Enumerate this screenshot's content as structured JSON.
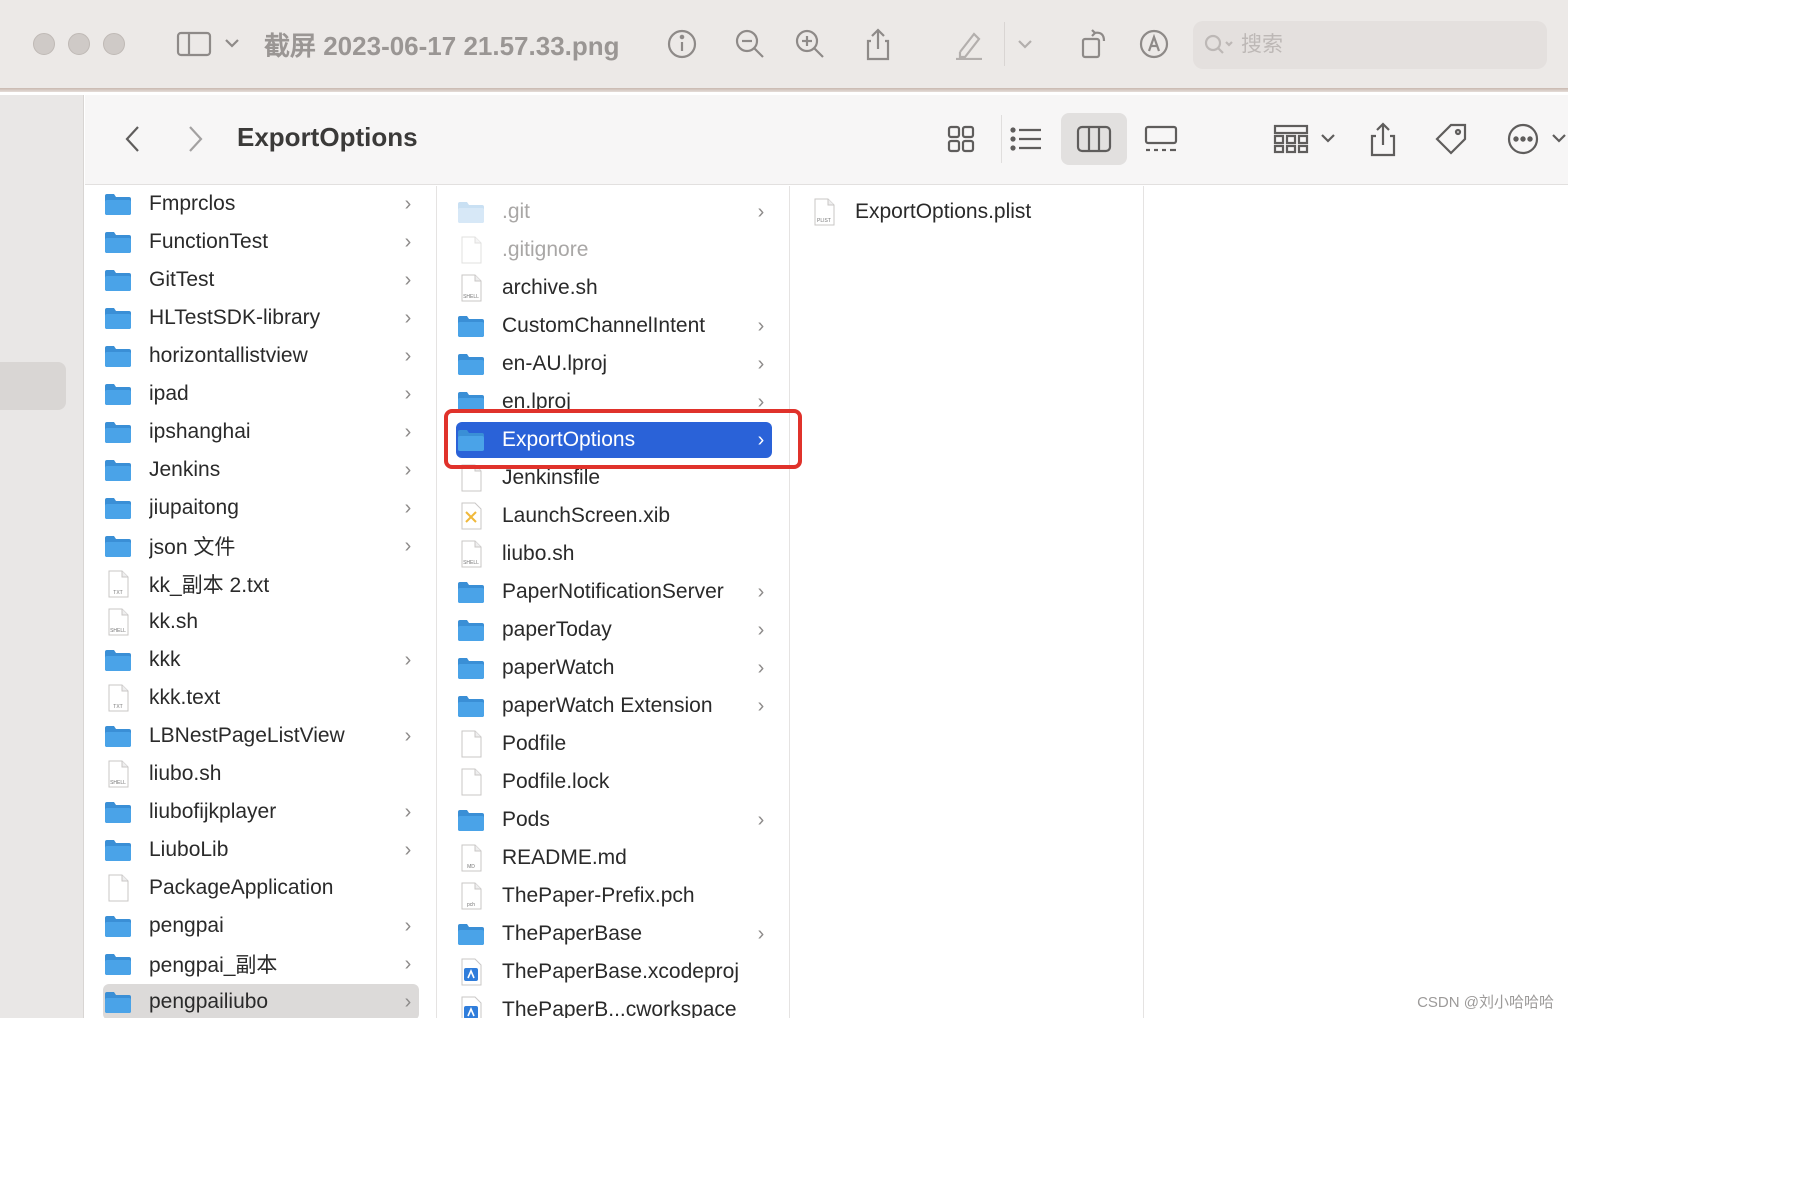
{
  "window": {
    "doc_title": "截屏 2023-06-17 21.57.33.png",
    "search_placeholder": "搜索"
  },
  "finder": {
    "title": "ExportOptions"
  },
  "columns": {
    "col1": [
      {
        "label": "Fmprclos",
        "kind": "folder",
        "chevron": true
      },
      {
        "label": "FunctionTest",
        "kind": "folder",
        "chevron": true
      },
      {
        "label": "GitTest",
        "kind": "folder",
        "chevron": true
      },
      {
        "label": "HLTestSDK-library",
        "kind": "folder",
        "chevron": true
      },
      {
        "label": "horizontallistview",
        "kind": "folder",
        "chevron": true
      },
      {
        "label": "ipad",
        "kind": "folder",
        "chevron": true
      },
      {
        "label": "ipshanghai",
        "kind": "folder",
        "chevron": true
      },
      {
        "label": "Jenkins",
        "kind": "folder",
        "chevron": true
      },
      {
        "label": "jiupaitong",
        "kind": "folder",
        "chevron": true
      },
      {
        "label": "json 文件",
        "kind": "folder",
        "chevron": true
      },
      {
        "label": "kk_副本 2.txt",
        "kind": "txt",
        "chevron": false
      },
      {
        "label": "kk.sh",
        "kind": "shell",
        "chevron": false
      },
      {
        "label": "kkk",
        "kind": "folder",
        "chevron": true
      },
      {
        "label": "kkk.text",
        "kind": "txt",
        "chevron": false
      },
      {
        "label": "LBNestPageListView",
        "kind": "folder",
        "chevron": true
      },
      {
        "label": "liubo.sh",
        "kind": "shell",
        "chevron": false
      },
      {
        "label": "liubofijkplayer",
        "kind": "folder",
        "chevron": true
      },
      {
        "label": "LiuboLib",
        "kind": "folder",
        "chevron": true
      },
      {
        "label": "PackageApplication",
        "kind": "file",
        "chevron": false
      },
      {
        "label": "pengpai",
        "kind": "folder",
        "chevron": true
      },
      {
        "label": "pengpai_副本",
        "kind": "folder",
        "chevron": true
      },
      {
        "label": "pengpailiubo",
        "kind": "folder",
        "chevron": true,
        "state": "parent-selected"
      }
    ],
    "col2": [
      {
        "label": ".git",
        "kind": "folder",
        "chevron": true,
        "state": "dim"
      },
      {
        "label": ".gitignore",
        "kind": "file",
        "chevron": false,
        "state": "dim"
      },
      {
        "label": "archive.sh",
        "kind": "shell",
        "chevron": false
      },
      {
        "label": "CustomChannelIntent",
        "kind": "folder",
        "chevron": true
      },
      {
        "label": "en-AU.lproj",
        "kind": "folder",
        "chevron": true
      },
      {
        "label": "en.lproj",
        "kind": "folder",
        "chevron": true
      },
      {
        "label": "ExportOptions",
        "kind": "folder",
        "chevron": true,
        "state": "selected"
      },
      {
        "label": "Jenkinsfile",
        "kind": "file",
        "chevron": false
      },
      {
        "label": "LaunchScreen.xib",
        "kind": "xib",
        "chevron": false
      },
      {
        "label": "liubo.sh",
        "kind": "shell",
        "chevron": false
      },
      {
        "label": "PaperNotificationServer",
        "kind": "folder",
        "chevron": true
      },
      {
        "label": "paperToday",
        "kind": "folder",
        "chevron": true
      },
      {
        "label": "paperWatch",
        "kind": "folder",
        "chevron": true
      },
      {
        "label": "paperWatch Extension",
        "kind": "folder",
        "chevron": true
      },
      {
        "label": "Podfile",
        "kind": "file",
        "chevron": false
      },
      {
        "label": "Podfile.lock",
        "kind": "file",
        "chevron": false
      },
      {
        "label": "Pods",
        "kind": "folder",
        "chevron": true
      },
      {
        "label": "README.md",
        "kind": "md",
        "chevron": false
      },
      {
        "label": "ThePaper-Prefix.pch",
        "kind": "pch",
        "chevron": false
      },
      {
        "label": "ThePaperBase",
        "kind": "folder",
        "chevron": true
      },
      {
        "label": "ThePaperBase.xcodeproj",
        "kind": "xcode",
        "chevron": false
      },
      {
        "label": "ThePaperB...cworkspace",
        "kind": "xcode",
        "chevron": false
      }
    ],
    "col3": [
      {
        "label": "ExportOptions.plist",
        "kind": "plist",
        "chevron": false
      }
    ]
  },
  "file_type_tags": {
    "txt": "TXT",
    "shell": "SHELL",
    "md": "MD",
    "pch": "pch",
    "plist": "PLIST"
  },
  "colors": {
    "selection": "#2a62d8",
    "highlight_box": "#e0322b",
    "folder": "#4aa3e8"
  },
  "watermark": "CSDN @刘小哈哈哈"
}
